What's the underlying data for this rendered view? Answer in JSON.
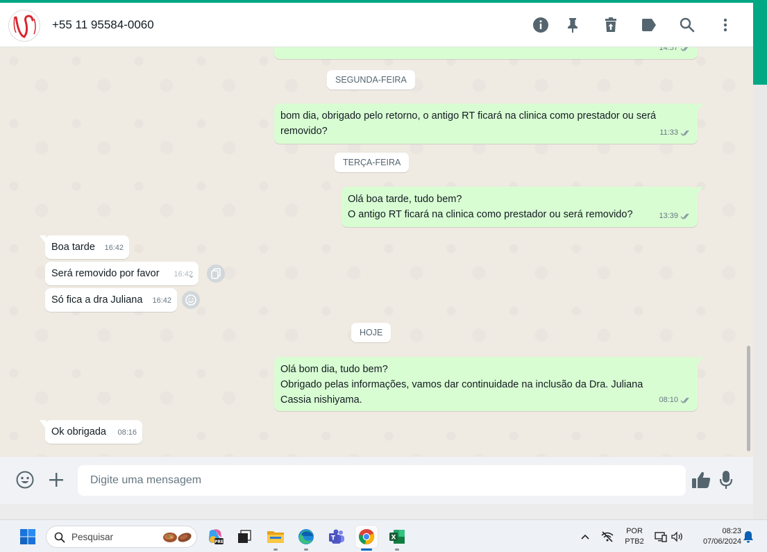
{
  "header": {
    "contact_name": "+55 11 95584-0060",
    "icons": [
      "info-icon",
      "pin-icon",
      "trash-icon",
      "label-icon",
      "search-icon",
      "more-vert-icon"
    ]
  },
  "chat": {
    "top_partial_time": "14:57",
    "days": [
      {
        "label": "SEGUNDA-FEIRA"
      },
      {
        "label": "TERÇA-FEIRA"
      },
      {
        "label": "HOJE"
      }
    ],
    "messages": [
      {
        "direction": "out",
        "lines": [
          "bom dia, obrigado pelo retorno, o antigo RT ficará na clinica como prestador ou será",
          "removido?"
        ],
        "time": "11:33",
        "status": "read"
      },
      {
        "direction": "out",
        "lines": [
          "Olá boa tarde, tudo bem?",
          "O antigo RT ficará na clinica como prestador ou será removido?"
        ],
        "time": "13:39",
        "status": "read"
      },
      {
        "direction": "in",
        "lines": [
          "Boa tarde"
        ],
        "time": "16:42"
      },
      {
        "direction": "in",
        "lines": [
          "Será removido por favor"
        ],
        "time": "16:42"
      },
      {
        "direction": "in",
        "lines": [
          "Só fica a dra Juliana"
        ],
        "time": "16:42"
      },
      {
        "direction": "out",
        "lines": [
          "Olá bom dia, tudo bem?",
          "Obrigado pelas informações, vamos dar continuidade na inclusão da Dra. Juliana",
          "Cassia nishiyama."
        ],
        "time": "08:10",
        "status": "read"
      },
      {
        "direction": "in",
        "lines": [
          "Ok obrigada"
        ],
        "time": "08:16"
      }
    ]
  },
  "composer": {
    "placeholder": "Digite uma mensagem",
    "icons": [
      "emoji-icon",
      "plus-icon",
      "thumbs-up-icon",
      "mic-icon"
    ]
  },
  "taskbar": {
    "search_label": "Pesquisar",
    "language_line1": "POR",
    "language_line2": "PTB2",
    "time": "08:23",
    "date": "07/06/2024"
  },
  "colors": {
    "accent": "#00a884",
    "outgoing_bubble": "#d9fdd3",
    "incoming_bubble": "#ffffff",
    "chat_background": "#efeae2",
    "read_tick": "#8696a0"
  }
}
